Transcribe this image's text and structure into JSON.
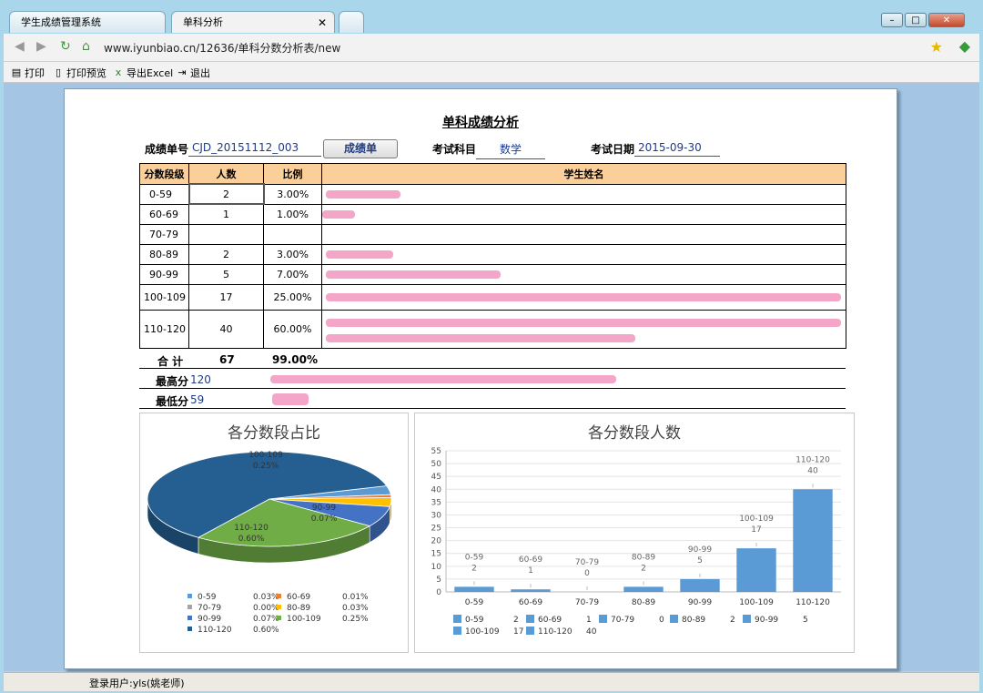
{
  "tabs": [
    {
      "label": "学生成绩管理系统"
    },
    {
      "label": "单科分析"
    }
  ],
  "address": {
    "url": "www.iyunbiao.cn/12636/单科分数分析表/new"
  },
  "toolbar": {
    "print": "打印",
    "preview": "打印预览",
    "export": "导出Excel",
    "exit": "退出"
  },
  "report": {
    "title": "单科成绩分析",
    "id_label": "成绩单号",
    "id_value": "CJD_20151112_003",
    "grade_button": "成绩单",
    "subject_label": "考试科目",
    "subject_value": "数学",
    "date_label": "考试日期",
    "date_value": "2015-09-30",
    "headers": [
      "分数段级",
      "人数",
      "比例",
      "学生姓名"
    ],
    "rows": [
      {
        "band": "0-59",
        "count": "2",
        "ratio": "3.00%"
      },
      {
        "band": "60-69",
        "count": "1",
        "ratio": "1.00%"
      },
      {
        "band": "70-79",
        "count": "",
        "ratio": ""
      },
      {
        "band": "80-89",
        "count": "2",
        "ratio": "3.00%"
      },
      {
        "band": "90-99",
        "count": "5",
        "ratio": "7.00%"
      },
      {
        "band": "100-109",
        "count": "17",
        "ratio": "25.00%"
      },
      {
        "band": "110-120",
        "count": "40",
        "ratio": "60.00%"
      }
    ],
    "total_label": "合 计",
    "total_count": "67",
    "total_ratio": "99.00%",
    "max_label": "最高分",
    "max_value": "120",
    "min_label": "最低分",
    "min_value": "59"
  },
  "chart_data": [
    {
      "type": "pie",
      "title": "各分数段占比",
      "labels": [
        "0-59",
        "60-69",
        "70-79",
        "80-89",
        "90-99",
        "100-109",
        "110-120"
      ],
      "values": [
        0.03,
        0.01,
        0.0,
        0.03,
        0.07,
        0.25,
        0.6
      ],
      "legend_values": [
        "0.03%",
        "0.01%",
        "0.00%",
        "0.03%",
        "0.07%",
        "0.25%",
        "0.60%"
      ],
      "colors": [
        "#5b9bd5",
        "#ed7d31",
        "#a5a5a5",
        "#ffc000",
        "#4472c4",
        "#70ad47",
        "#255e91"
      ],
      "slice_labels": [
        {
          "name": "100-109",
          "value": "0.25%"
        },
        {
          "name": "110-120",
          "value": "0.60%"
        },
        {
          "name": "90-99",
          "value": "0.07%"
        }
      ],
      "legend": "bottom"
    },
    {
      "type": "bar",
      "title": "各分数段人数",
      "categories": [
        "0-59",
        "60-69",
        "70-79",
        "80-89",
        "90-99",
        "100-109",
        "110-120"
      ],
      "values": [
        2,
        1,
        0,
        2,
        5,
        17,
        40
      ],
      "ylim": [
        0,
        55
      ],
      "yticks": [
        0,
        5,
        10,
        15,
        20,
        25,
        30,
        35,
        40,
        45,
        50,
        55
      ],
      "color": "#5b9bd5",
      "grid": true,
      "legend": "bottom"
    }
  ],
  "status": {
    "user": "登录用户:yls(姚老师)"
  }
}
